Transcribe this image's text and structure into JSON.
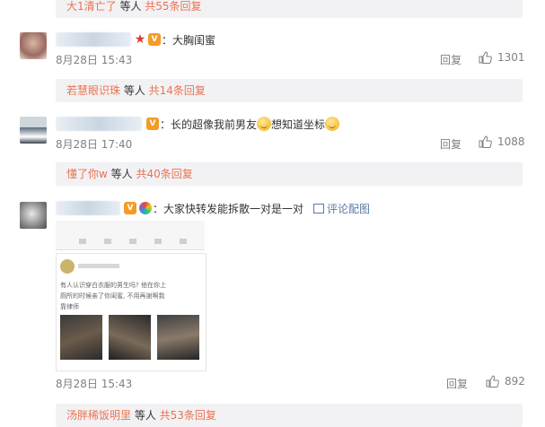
{
  "threads": [
    {
      "reply_bar": {
        "who": "大1清亡了",
        "mid": " 等人 ",
        "more": "共55条回复"
      }
    },
    {
      "comment": {
        "text": "：大胸闺蜜",
        "time": "8月28日 15:43",
        "reply": "回复",
        "likes": "1301"
      },
      "reply_bar": {
        "who": "若慧眼识珠",
        "mid": " 等人 ",
        "more": "共14条回复"
      }
    },
    {
      "comment": {
        "text_a": "：长的超像我前男友",
        "text_b": "想知道坐标",
        "time": "8月28日 17:40",
        "reply": "回复",
        "likes": "1088"
      },
      "reply_bar": {
        "who": "懂了你w",
        "mid": " 等人 ",
        "more": "共40条回复"
      }
    },
    {
      "comment": {
        "text": "：大家快转发能拆散一对是一对",
        "pic_comment": "评论配图",
        "time": "8月28日 15:43",
        "reply": "回复",
        "likes": "892"
      },
      "image": {
        "handwriting_line1": "有人认识穿白衣服的男生吗? 他在你上",
        "handwriting_line2": "厕所的时候亲了你闺蜜, 不用再谢啊我",
        "handwriting_line3": "靠律师"
      },
      "reply_bar": {
        "who": "汤胖稀饭明里",
        "mid": " 等人 ",
        "more": "共53条回复"
      }
    }
  ],
  "colors": {
    "accent": "#eb7350",
    "muted": "#808080",
    "bar_bg": "#f2f2f5"
  }
}
